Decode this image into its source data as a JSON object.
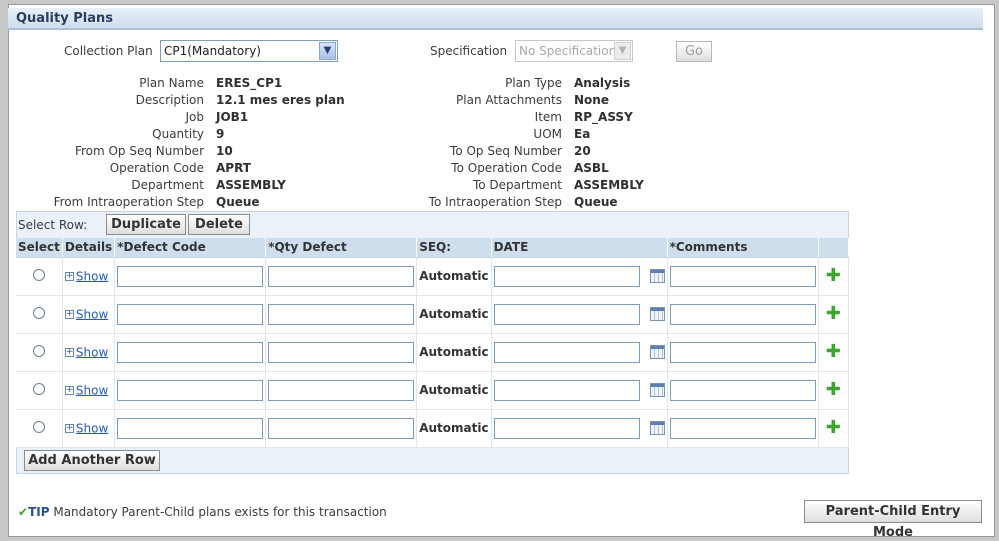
{
  "section": {
    "title": "Quality Plans"
  },
  "collection_plan": {
    "label": "Collection Plan",
    "value": "CP1(Mandatory)"
  },
  "specification": {
    "label": "Specification",
    "value": "No Specification"
  },
  "go_label": "Go",
  "details_left": [
    {
      "label": "Plan Name",
      "value": "ERES_CP1"
    },
    {
      "label": "Description",
      "value": "12.1 mes eres plan"
    },
    {
      "label": "Job",
      "value": "JOB1"
    },
    {
      "label": "Quantity",
      "value": "9"
    },
    {
      "label": "From Op Seq Number",
      "value": "10"
    },
    {
      "label": "Operation Code",
      "value": "APRT"
    },
    {
      "label": "Department",
      "value": "ASSEMBLY"
    },
    {
      "label": "From Intraoperation Step",
      "value": "Queue"
    }
  ],
  "details_right": [
    {
      "label": "Plan Type",
      "value": "Analysis"
    },
    {
      "label": "Plan Attachments",
      "value": "None"
    },
    {
      "label": "Item",
      "value": "RP_ASSY"
    },
    {
      "label": "UOM",
      "value": "Ea"
    },
    {
      "label": "To Op Seq Number",
      "value": "20"
    },
    {
      "label": "To Operation Code",
      "value": "ASBL"
    },
    {
      "label": "To Department",
      "value": "ASSEMBLY"
    },
    {
      "label": "To Intraoperation Step",
      "value": "Queue"
    }
  ],
  "toolbar": {
    "select_row_label": "Select Row:",
    "duplicate_label": "Duplicate",
    "delete_label": "Delete"
  },
  "table": {
    "headers": [
      "Select",
      "Details",
      "*Defect Code",
      "*Qty Defect",
      "SEQ:",
      "DATE",
      "*Comments"
    ],
    "show_label": "Show",
    "seq_value": "Automatic",
    "row_count": 5
  },
  "add_row_label": "Add Another Row",
  "tip": {
    "label": "TIP",
    "text": "Mandatory Parent-Child plans exists for this transaction"
  },
  "parent_child_label": "Parent-Child Entry Mode",
  "icons": {
    "add": "add-icon",
    "calendar": "calendar-icon",
    "check": "check-icon"
  },
  "colors": {
    "header_bg": "#cfdeed",
    "link": "#2a5db0",
    "accent_green": "#3fa233"
  }
}
